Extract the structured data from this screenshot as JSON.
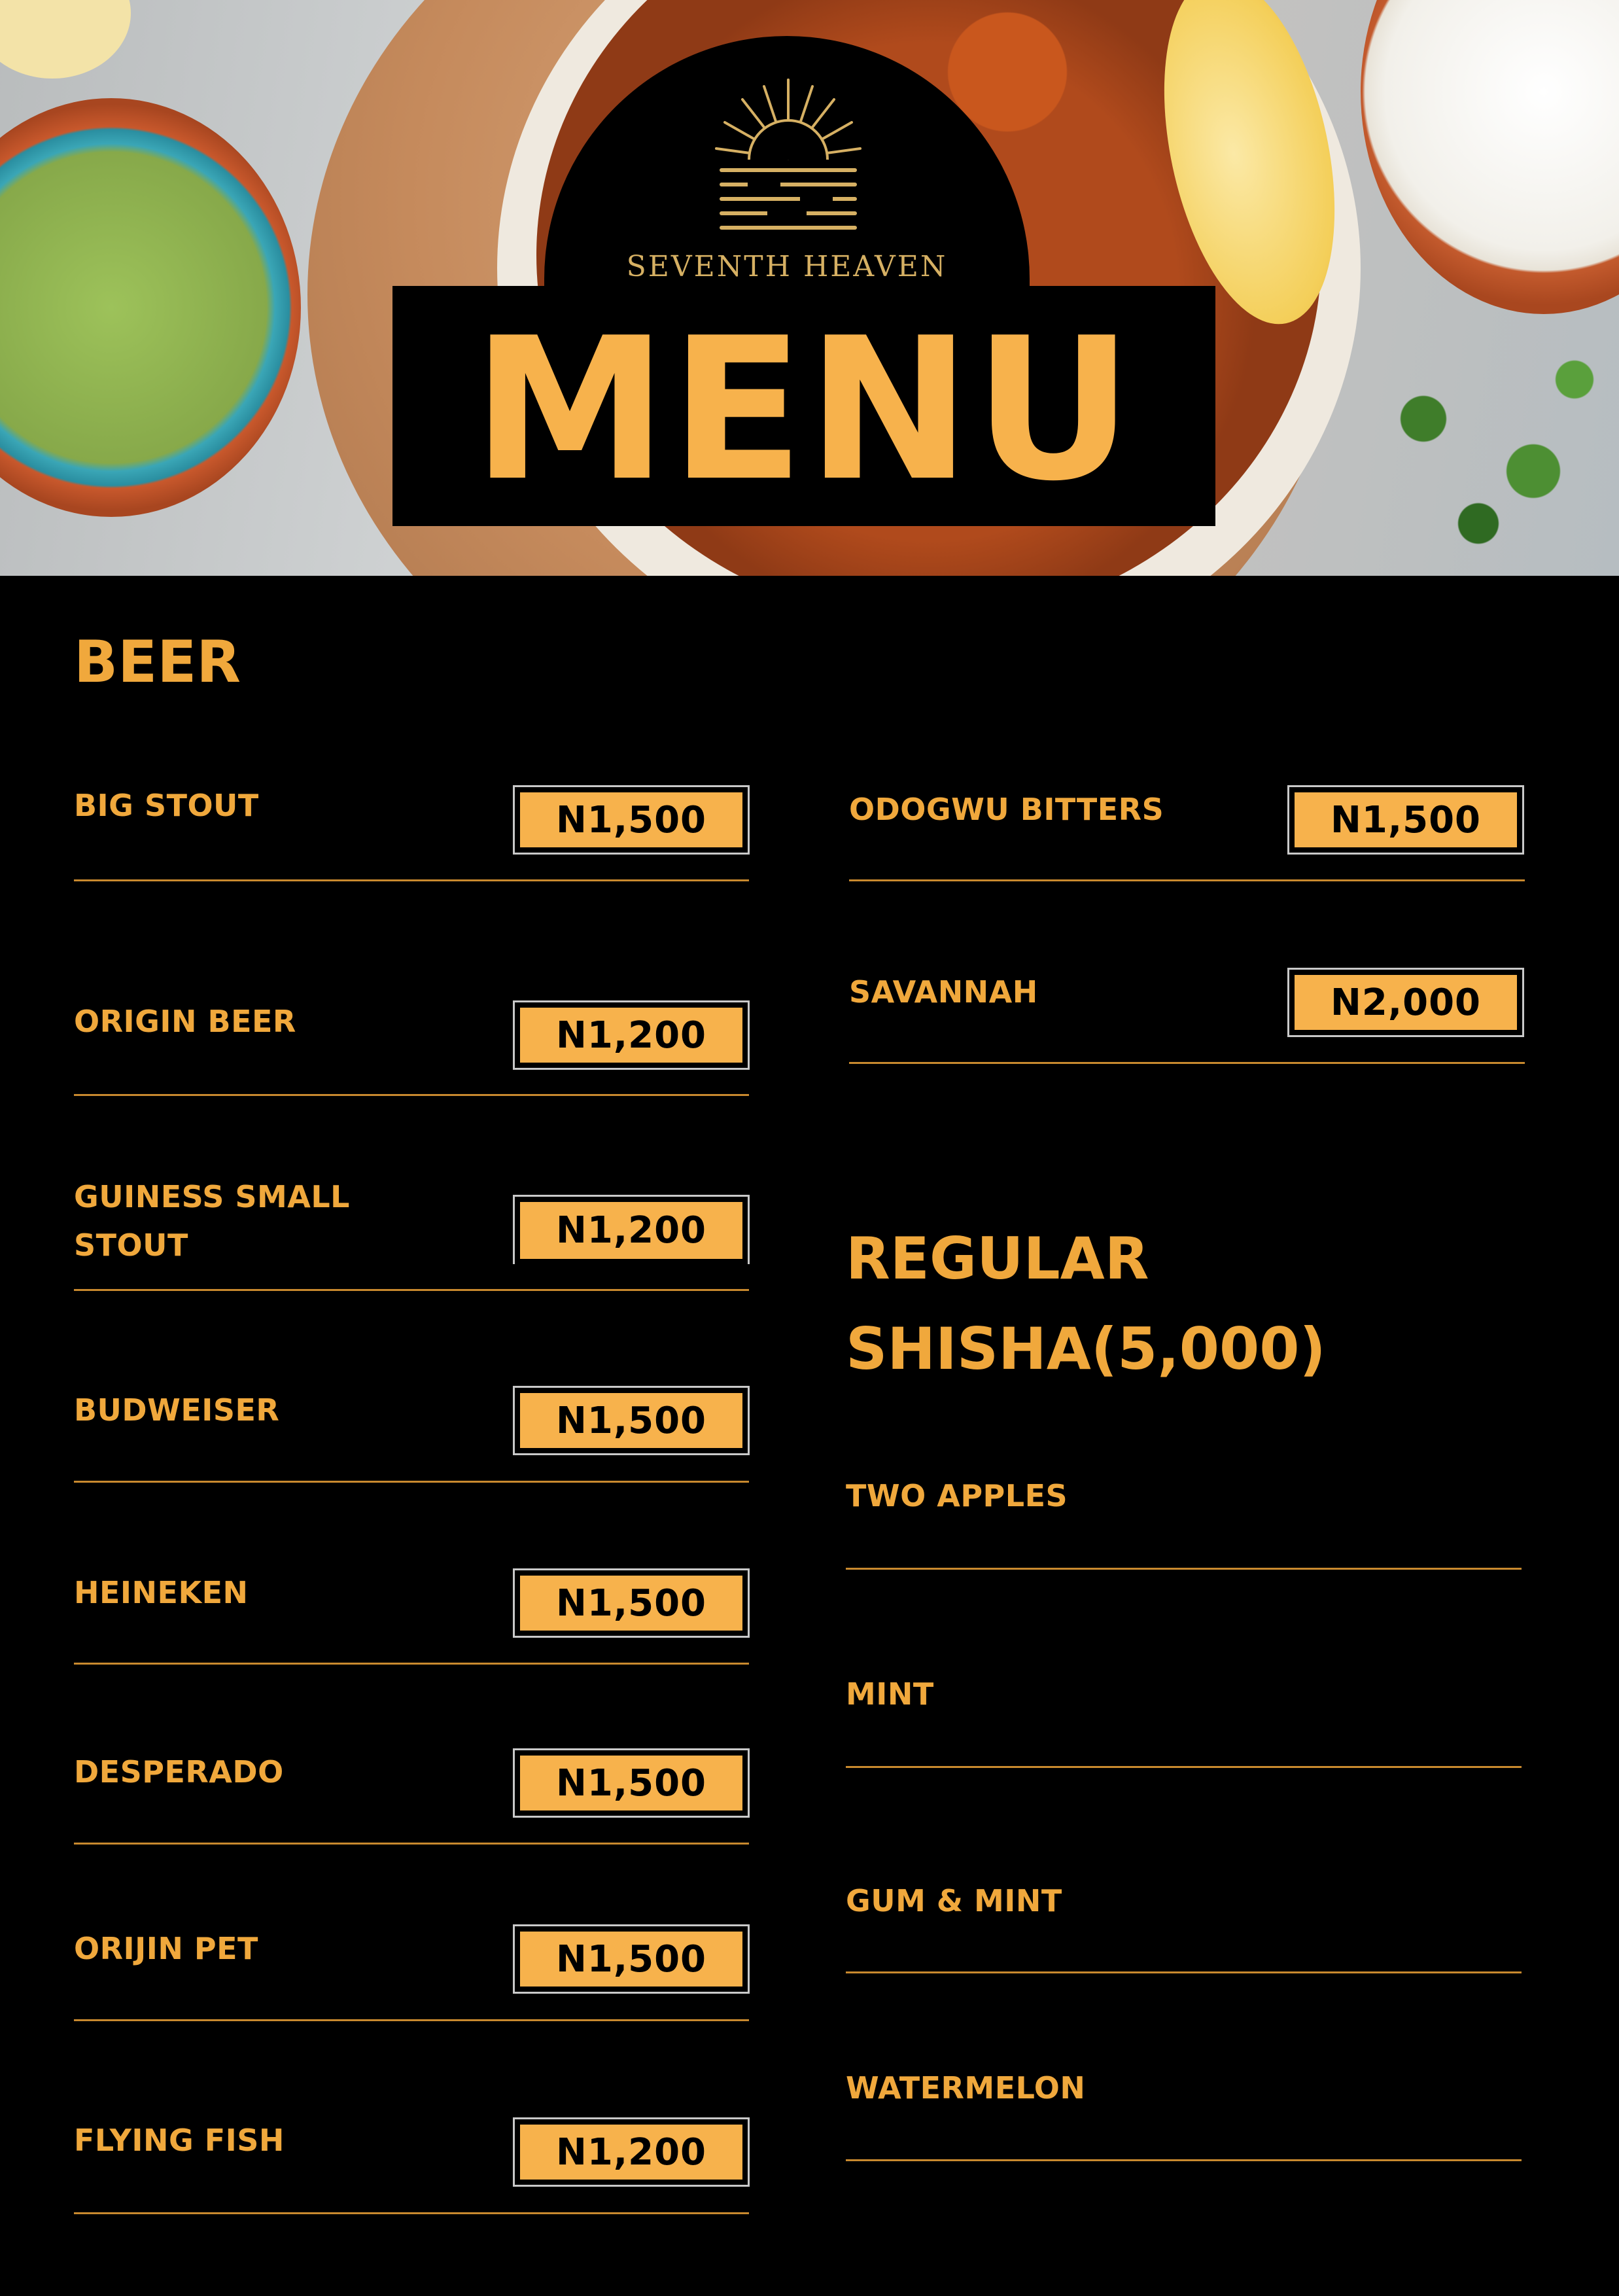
{
  "brand": {
    "name": "SEVENTH HEAVEN",
    "accent_color": "#f7b24c",
    "heading_color": "#f0a83c",
    "background_color": "#000000"
  },
  "menu_title": "MENU",
  "sections": [
    {
      "heading": "BEER",
      "items": [
        {
          "name": "BIG STOUT",
          "price": "N1,500"
        },
        {
          "name": "ORIGIN BEER",
          "price": "N1,200"
        },
        {
          "name": "GUINESS SMALL\nSTOUT",
          "price": "N1,200"
        },
        {
          "name": "BUDWEISER",
          "price": "N1,500"
        },
        {
          "name": "HEINEKEN",
          "price": "N1,500"
        },
        {
          "name": "DESPERADO",
          "price": "N1,500"
        },
        {
          "name": "ORIJIN PET",
          "price": "N1,500"
        },
        {
          "name": "FLYING FISH",
          "price": "N1,200"
        },
        {
          "name": "ODOGWU BITTERS",
          "price": "N1,500"
        },
        {
          "name": "SAVANNAH",
          "price": "N2,000"
        }
      ]
    },
    {
      "heading": "REGULAR\nSHISHA(5,000)",
      "items": [
        {
          "name": "TWO APPLES"
        },
        {
          "name": "MINT"
        },
        {
          "name": "GUM & MINT"
        },
        {
          "name": "WATERMELON"
        }
      ]
    }
  ]
}
